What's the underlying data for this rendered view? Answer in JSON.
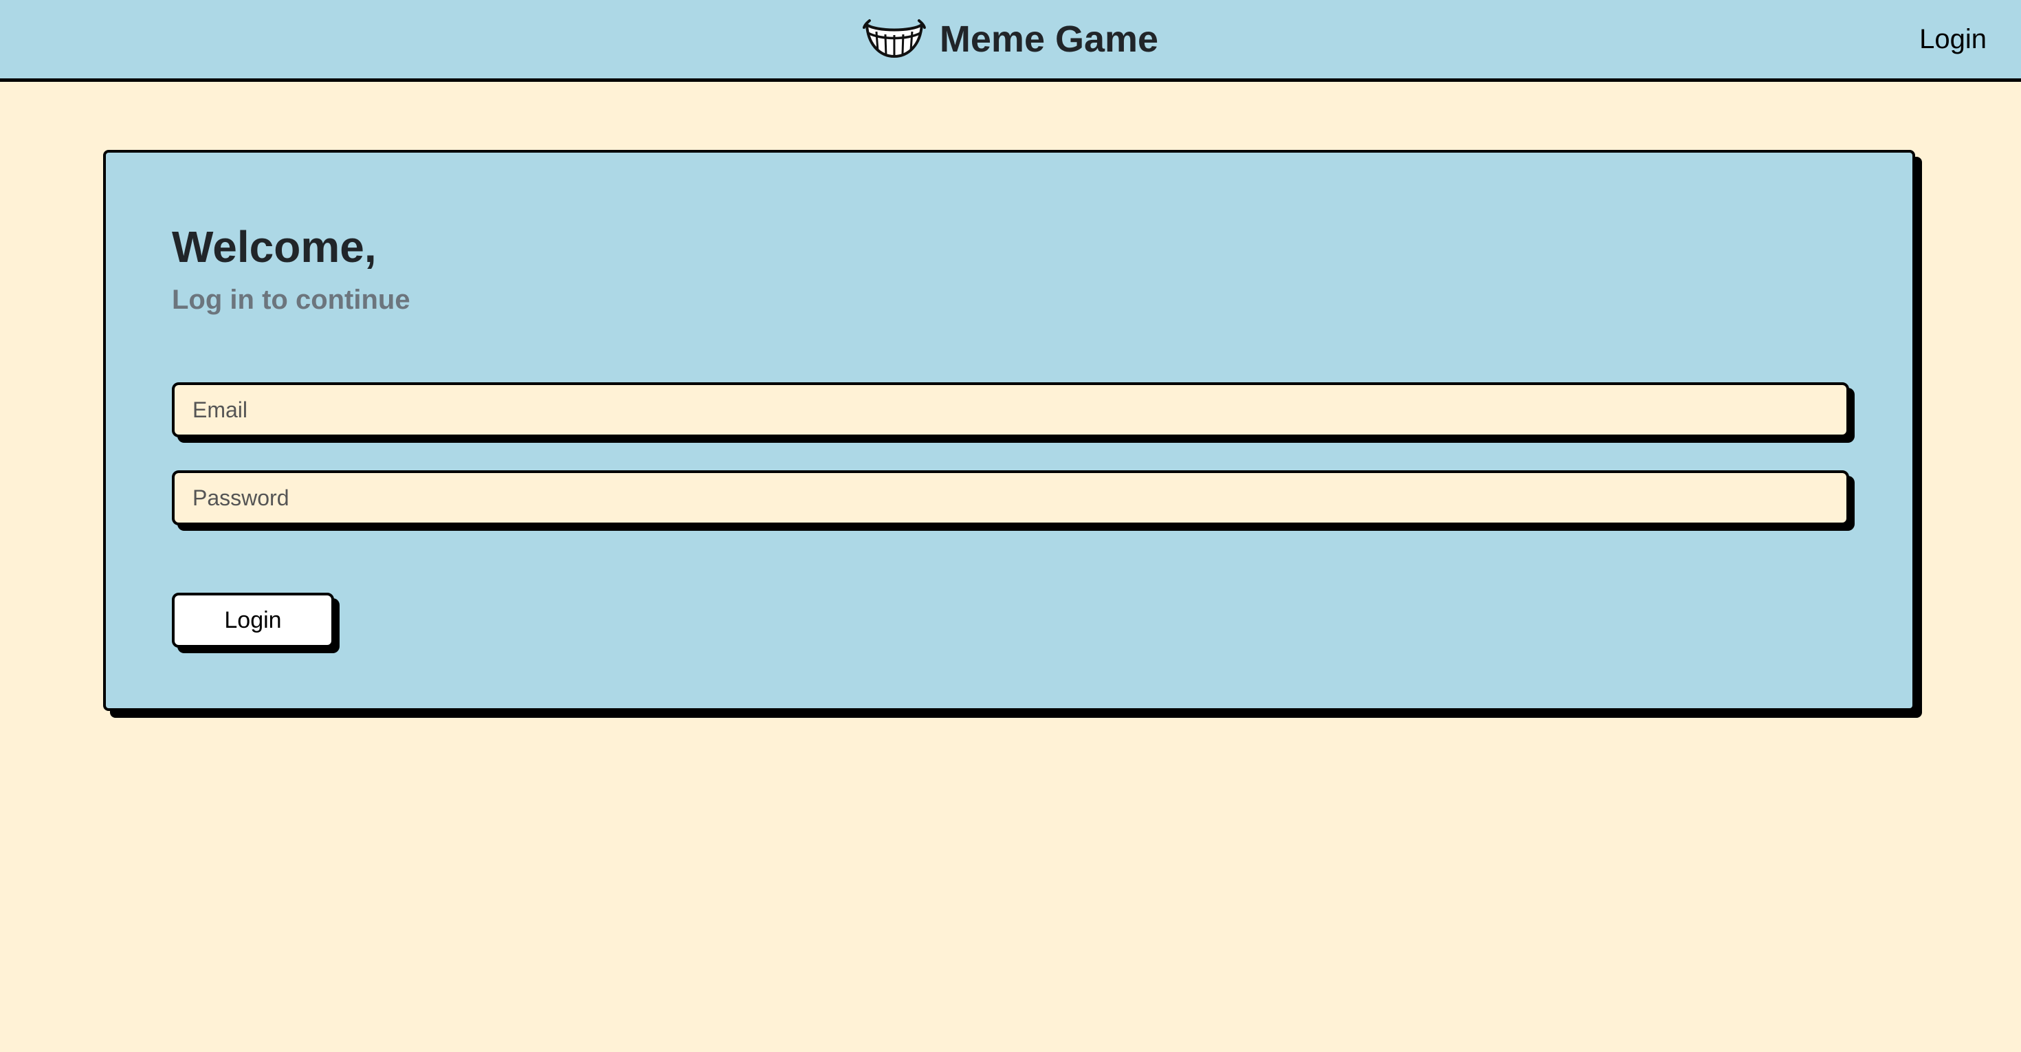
{
  "navbar": {
    "brand_icon": "grin-teeth-icon",
    "brand_title": "Meme Game",
    "login_link": "Login",
    "background": "#add8e6"
  },
  "login_card": {
    "heading": "Welcome,",
    "subheading": "Log in to continue",
    "email_placeholder": "Email",
    "password_placeholder": "Password",
    "submit_label": "Login",
    "background": "#add8e6"
  },
  "page": {
    "background": "#fff2d6"
  }
}
